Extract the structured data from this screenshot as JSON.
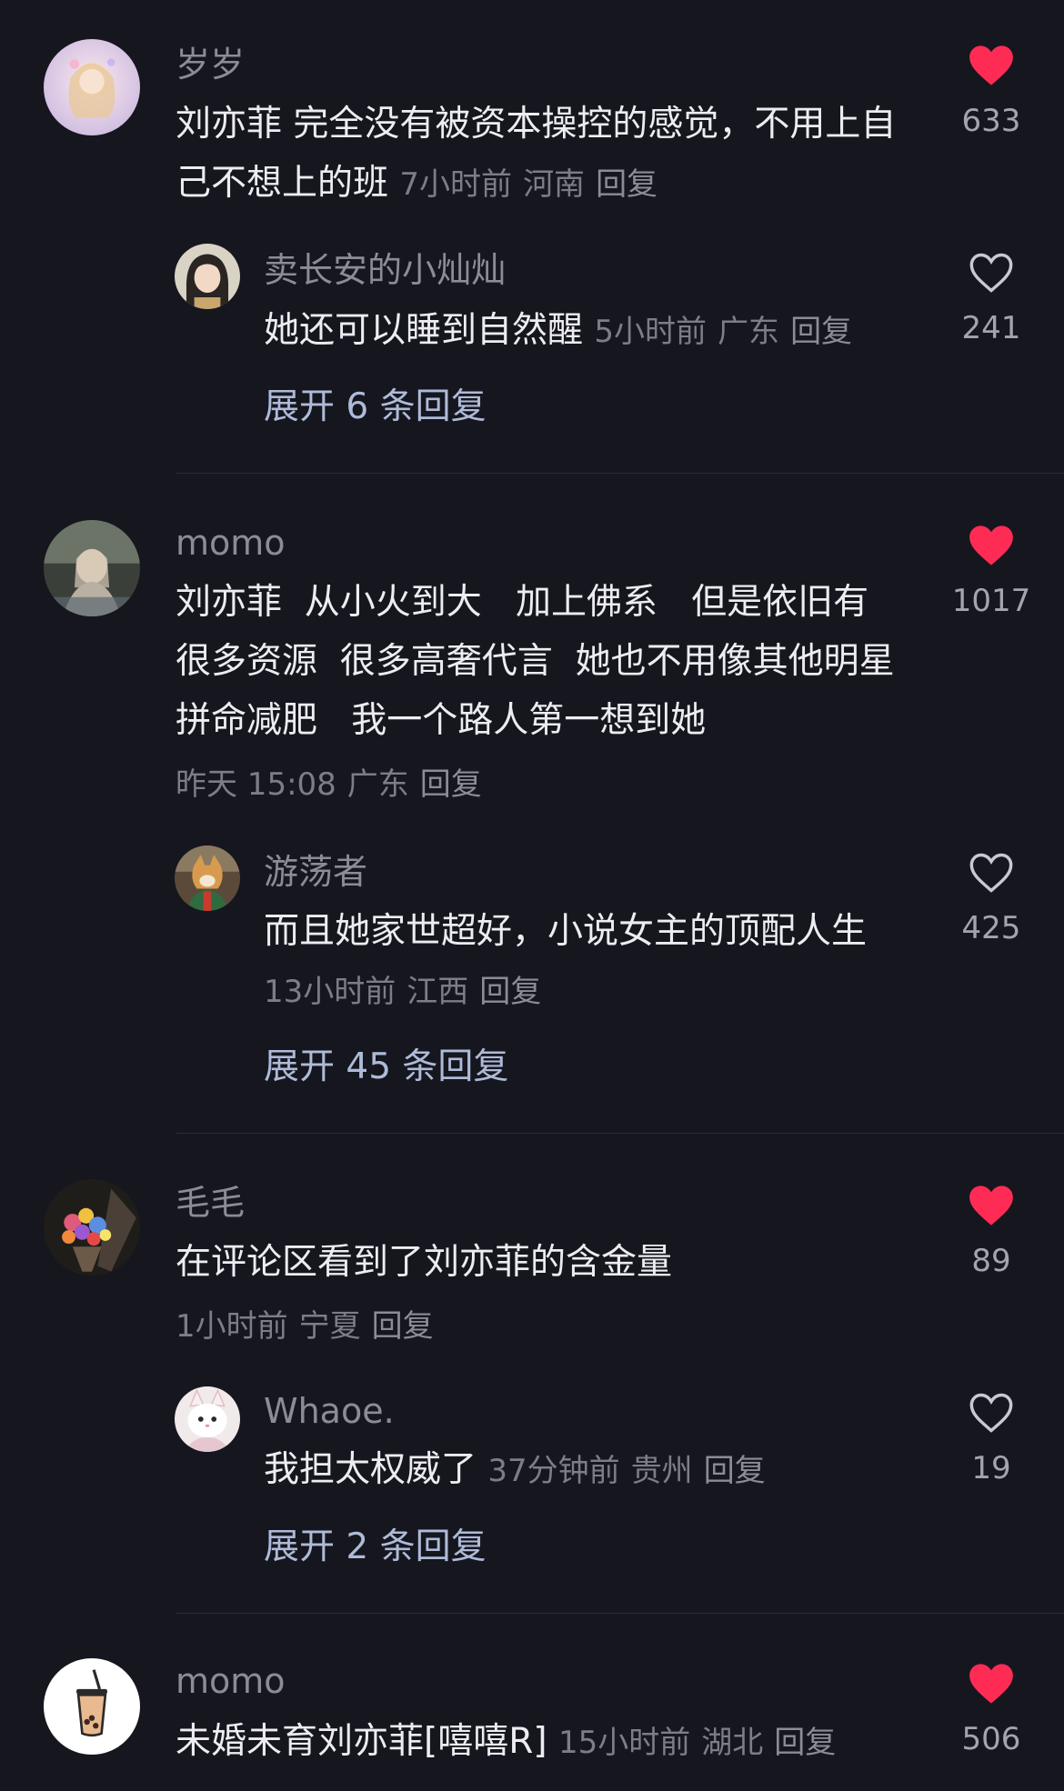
{
  "comments": [
    {
      "username": "岁岁",
      "text": "刘亦菲 完全没有被资本操控的感觉，不用上自己不想上的班",
      "time": "7小时前",
      "location": "河南",
      "reply_label": "回复",
      "likes": "633",
      "liked": true,
      "reply": {
        "username": "卖长安的小灿灿",
        "text": "她还可以睡到自然醒",
        "time": "5小时前",
        "location": "广东",
        "reply_label": "回复",
        "likes": "241",
        "liked": false
      },
      "expand_label": "展开 6 条回复"
    },
    {
      "username": "momo",
      "text": "刘亦菲  从小火到大   加上佛系   但是依旧有很多资源  很多高奢代言  她也不用像其他明星拼命减肥   我一个路人第一想到她",
      "time": "昨天 15:08",
      "location": "广东",
      "reply_label": "回复",
      "likes": "1017",
      "liked": true,
      "reply": {
        "username": "游荡者",
        "text": "而且她家世超好，小说女主的顶配人生",
        "time": "13小时前",
        "location": "江西",
        "reply_label": "回复",
        "likes": "425",
        "liked": false
      },
      "expand_label": "展开 45 条回复"
    },
    {
      "username": "毛毛",
      "text": "在评论区看到了刘亦菲的含金量",
      "time": "1小时前",
      "location": "宁夏",
      "reply_label": "回复",
      "likes": "89",
      "liked": true,
      "reply": {
        "username": "Whaoe.",
        "text": "我担太权威了",
        "time": "37分钟前",
        "location": "贵州",
        "reply_label": "回复",
        "likes": "19",
        "liked": false
      },
      "expand_label": "展开 2 条回复"
    },
    {
      "username": "momo",
      "text": "未婚未育刘亦菲[嘻嘻R]",
      "time": "15小时前",
      "location": "湖北",
      "reply_label": "回复",
      "likes": "506",
      "liked": true
    }
  ],
  "colors": {
    "background": "#16161f",
    "like_red": "#fe2c55",
    "expand_link": "#aebbd8",
    "meta_gray": "#7d7d88"
  },
  "icons": {
    "liked": "heart-filled-icon",
    "unliked": "heart-outline-icon"
  }
}
